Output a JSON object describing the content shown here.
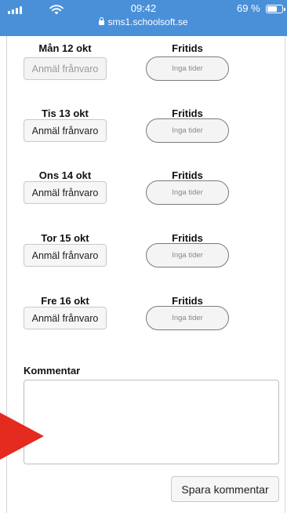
{
  "status_bar": {
    "time": "09:42",
    "url": "sms1.schoolsoft.se",
    "battery_text": "69 %",
    "battery_level": 0.69,
    "signal_icon": "signal-icon",
    "wifi_icon": "wifi-icon",
    "battery_icon": "battery-icon",
    "lock_icon": "lock-icon",
    "bar_color": "#4a90d9"
  },
  "days": [
    {
      "label": "Mån 12 okt",
      "absence_label": "Anmäl frånvaro",
      "absence_enabled": false,
      "fritids_label": "Fritids",
      "times_label": "Inga tider"
    },
    {
      "label": "Tis 13 okt",
      "absence_label": "Anmäl frånvaro",
      "absence_enabled": true,
      "fritids_label": "Fritids",
      "times_label": "Inga tider"
    },
    {
      "label": "Ons 14 okt",
      "absence_label": "Anmäl frånvaro",
      "absence_enabled": true,
      "fritids_label": "Fritids",
      "times_label": "Inga tider"
    },
    {
      "label": "Tor 15 okt",
      "absence_label": "Anmäl frånvaro",
      "absence_enabled": true,
      "fritids_label": "Fritids",
      "times_label": "Inga tider"
    },
    {
      "label": "Fre 16 okt",
      "absence_label": "Anmäl frånvaro",
      "absence_enabled": true,
      "fritids_label": "Fritids",
      "times_label": "Inga tider"
    }
  ],
  "comment": {
    "label": "Kommentar",
    "value": "",
    "save_label": "Spara kommentar"
  },
  "annotation": {
    "arrow_icon": "red-arrow-icon",
    "color": "#e52a1f"
  }
}
